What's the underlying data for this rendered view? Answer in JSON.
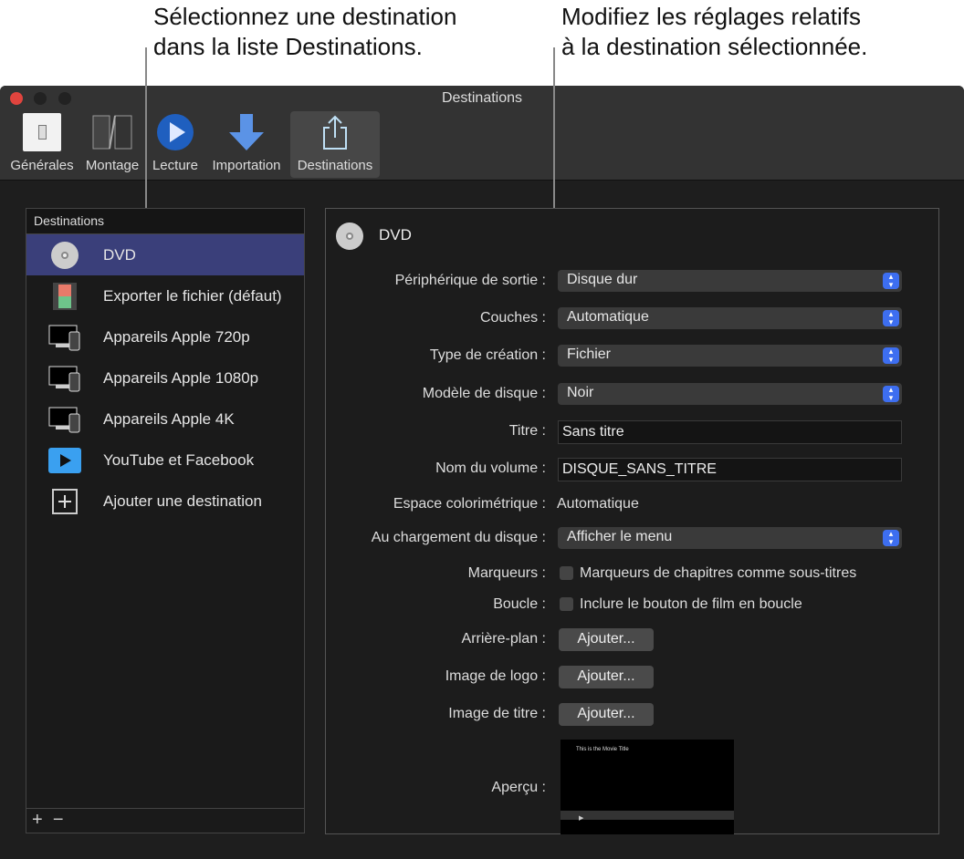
{
  "callouts": {
    "left": [
      "Sélectionnez une destination",
      "dans la liste Destinations."
    ],
    "right": [
      "Modifiez les réglages relatifs",
      "à la destination sélectionnée."
    ]
  },
  "window": {
    "title": "Destinations"
  },
  "toolbar": [
    {
      "label": "Générales",
      "icon": "switch-icon"
    },
    {
      "label": "Montage",
      "icon": "film-icon"
    },
    {
      "label": "Lecture",
      "icon": "play-icon"
    },
    {
      "label": "Importation",
      "icon": "download-arrow-icon"
    },
    {
      "label": "Destinations",
      "icon": "share-icon",
      "selected": true
    }
  ],
  "list": {
    "header": "Destinations",
    "items": [
      {
        "label": "DVD",
        "icon": "dvd-icon",
        "selected": true
      },
      {
        "label": "Exporter le fichier (défaut)",
        "icon": "film-file-icon"
      },
      {
        "label": "Appareils Apple 720p",
        "icon": "apple-devices-icon"
      },
      {
        "label": "Appareils Apple 1080p",
        "icon": "apple-devices-icon"
      },
      {
        "label": "Appareils Apple 4K",
        "icon": "apple-devices-icon"
      },
      {
        "label": "YouTube et Facebook",
        "icon": "video-icon"
      },
      {
        "label": "Ajouter une destination",
        "icon": "plus-box-icon"
      }
    ],
    "add": "+",
    "remove": "−"
  },
  "panel": {
    "title": "DVD",
    "output_device": {
      "label": "Périphérique de sortie :",
      "value": "Disque dur"
    },
    "layers": {
      "label": "Couches :",
      "value": "Automatique"
    },
    "creation_type": {
      "label": "Type de création :",
      "value": "Fichier"
    },
    "disc_template": {
      "label": "Modèle de disque :",
      "value": "Noir"
    },
    "title_field": {
      "label": "Titre :",
      "value": "Sans titre"
    },
    "volume_name": {
      "label": "Nom du volume :",
      "value": "DISQUE_SANS_TITRE"
    },
    "color_space": {
      "label": "Espace colorimétrique :",
      "value": "Automatique"
    },
    "on_load": {
      "label": "Au chargement du disque :",
      "value": "Afficher le menu"
    },
    "markers": {
      "label": "Marqueurs :",
      "checkbox": "Marqueurs de chapitres comme sous-titres",
      "checked": false
    },
    "loop": {
      "label": "Boucle :",
      "checkbox": "Inclure le bouton de film en boucle",
      "checked": false
    },
    "background": {
      "label": "Arrière-plan :",
      "button": "Ajouter..."
    },
    "logo": {
      "label": "Image de logo :",
      "button": "Ajouter..."
    },
    "title_image": {
      "label": "Image de titre :",
      "button": "Ajouter..."
    },
    "preview": {
      "label": "Aperçu :",
      "movie_title": "This is the Movie Title"
    }
  }
}
